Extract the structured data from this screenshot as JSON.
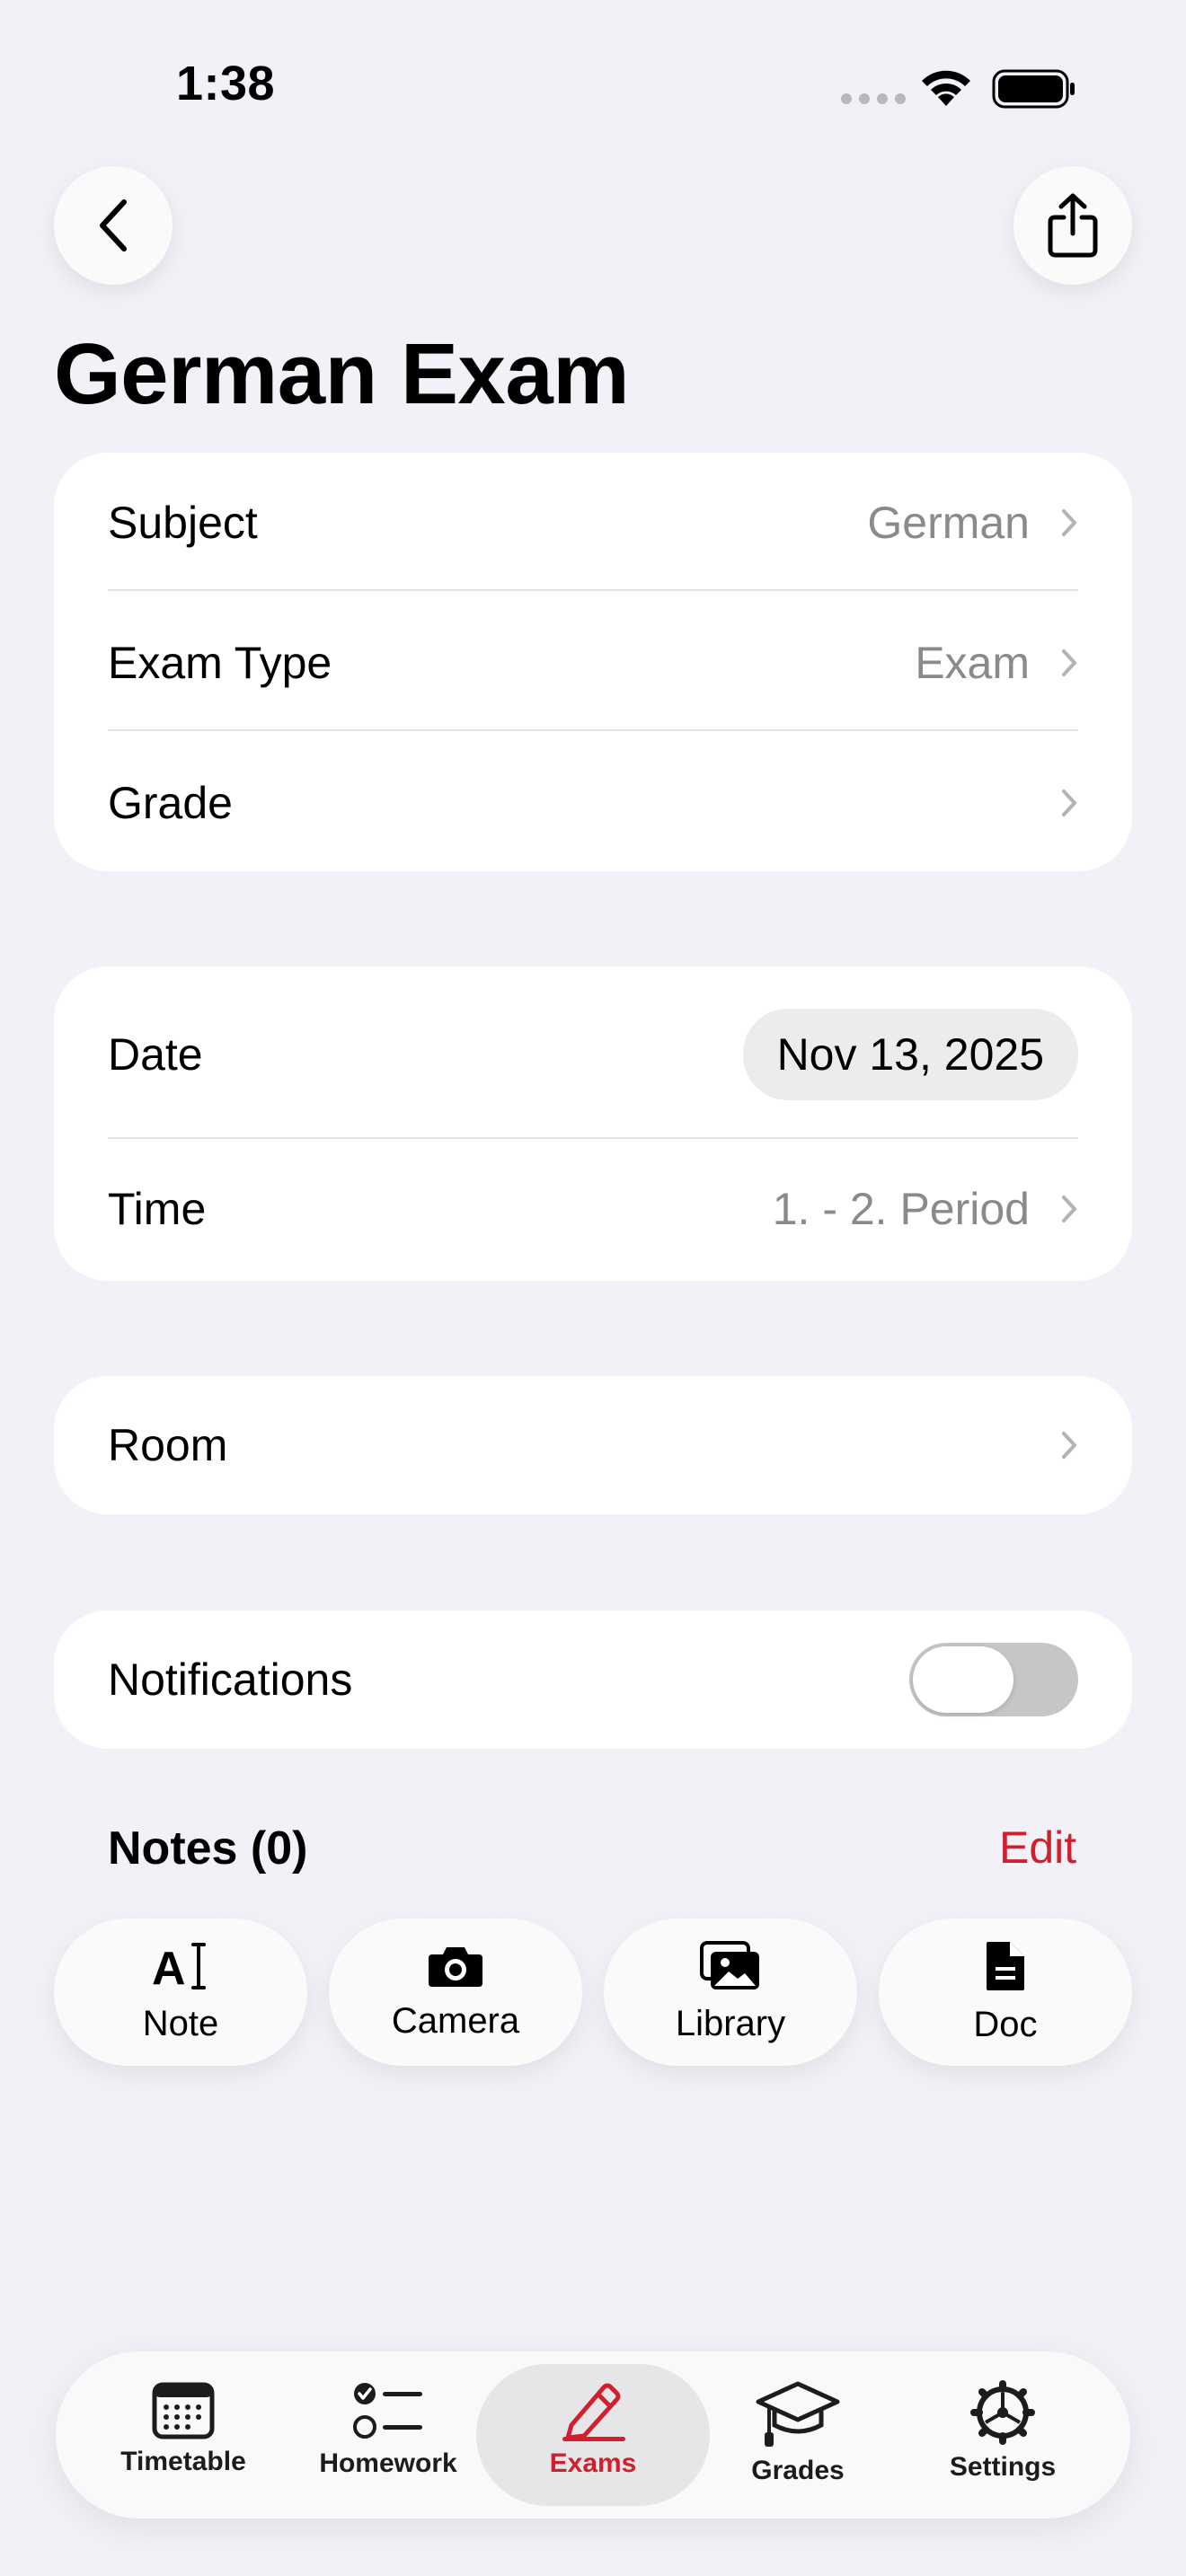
{
  "status_bar": {
    "time": "1:38"
  },
  "nav": {
    "back_icon": "chevron-left-icon",
    "share_icon": "share-icon"
  },
  "page": {
    "title": "German Exam"
  },
  "details": {
    "subject": {
      "label": "Subject",
      "value": "German"
    },
    "exam_type": {
      "label": "Exam Type",
      "value": "Exam"
    },
    "grade": {
      "label": "Grade",
      "value": ""
    }
  },
  "schedule": {
    "date": {
      "label": "Date",
      "value": "Nov 13, 2025"
    },
    "time": {
      "label": "Time",
      "value": "1. - 2. Period"
    }
  },
  "room": {
    "label": "Room"
  },
  "notifications": {
    "label": "Notifications",
    "enabled": false
  },
  "notes": {
    "title": "Notes (0)",
    "edit_label": "Edit",
    "actions": [
      {
        "label": "Note",
        "icon": "text-cursor-icon"
      },
      {
        "label": "Camera",
        "icon": "camera-icon"
      },
      {
        "label": "Library",
        "icon": "photo-library-icon"
      },
      {
        "label": "Doc",
        "icon": "document-icon"
      }
    ]
  },
  "tabs": [
    {
      "label": "Timetable",
      "icon": "calendar-icon",
      "active": false
    },
    {
      "label": "Homework",
      "icon": "checklist-icon",
      "active": false
    },
    {
      "label": "Exams",
      "icon": "pencil-icon",
      "active": true
    },
    {
      "label": "Grades",
      "icon": "graduation-cap-icon",
      "active": false
    },
    {
      "label": "Settings",
      "icon": "gear-icon",
      "active": false
    }
  ],
  "colors": {
    "accent": "#d0202f",
    "background": "#f2f1f7",
    "secondary_text": "#8a8a8e"
  }
}
